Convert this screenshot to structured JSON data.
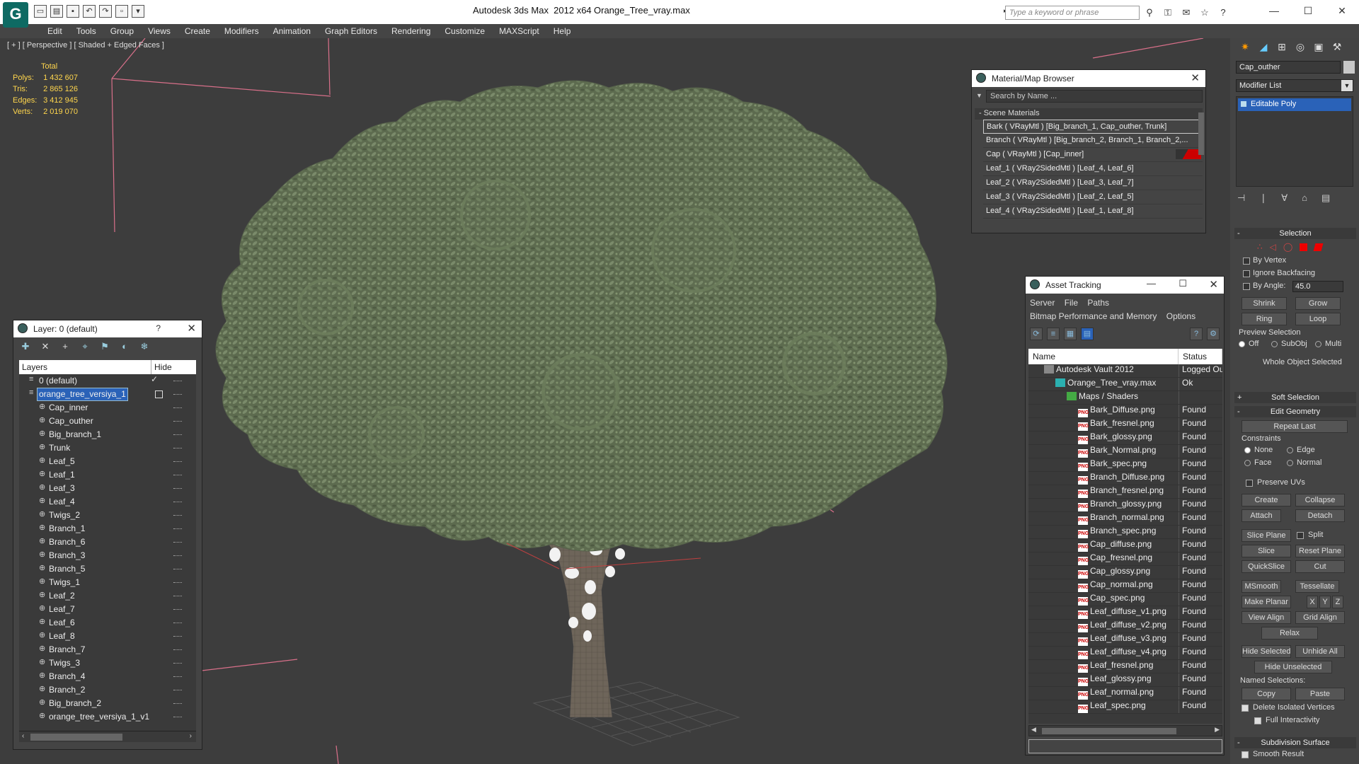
{
  "titlebar": {
    "app_title": "Autodesk 3ds Max  2012 x64",
    "file_name": "Orange_Tree_vray.max",
    "search_placeholder": "Type a keyword or phrase"
  },
  "menu": [
    "Edit",
    "Tools",
    "Group",
    "Views",
    "Create",
    "Modifiers",
    "Animation",
    "Graph Editors",
    "Rendering",
    "Customize",
    "MAXScript",
    "Help"
  ],
  "viewport": {
    "label": "[ + ] [ Perspective ] [ Shaded + Edged Faces ]",
    "stats_header": "Total",
    "stats": [
      {
        "label": "Polys:",
        "value": "1 432 607"
      },
      {
        "label": "Tris:",
        "value": "2 865 126"
      },
      {
        "label": "Edges:",
        "value": "3 412 945"
      },
      {
        "label": "Verts:",
        "value": "2 019 070"
      }
    ]
  },
  "material_browser": {
    "title": "Material/Map Browser",
    "search_placeholder": "Search by Name ...",
    "section": "- Scene Materials",
    "items": [
      "Bark  ( VRayMtl )  [Big_branch_1, Cap_outher, Trunk]",
      "Branch  ( VRayMtl )  [Big_branch_2, Branch_1, Branch_2,...",
      "Cap  ( VRayMtl )  [Cap_inner]",
      "Leaf_1  ( VRay2SidedMtl )  [Leaf_4, Leaf_6]",
      "Leaf_2  ( VRay2SidedMtl )  [Leaf_3, Leaf_7]",
      "Leaf_3  ( VRay2SidedMtl )  [Leaf_2, Leaf_5]",
      "Leaf_4  ( VRay2SidedMtl )  [Leaf_1, Leaf_8]"
    ]
  },
  "asset_tracking": {
    "title": "Asset Tracking",
    "menu1": [
      "Server",
      "File",
      "Paths"
    ],
    "menu2": [
      "Bitmap Performance and Memory",
      "Options"
    ],
    "col_name": "Name",
    "col_status": "Status",
    "rows": [
      {
        "name": "Autodesk Vault 2012",
        "status": "Logged Ou",
        "icon": "vault",
        "indent": 0
      },
      {
        "name": "Orange_Tree_vray.max",
        "status": "Ok",
        "icon": "max",
        "indent": 1
      },
      {
        "name": "Maps / Shaders",
        "status": "",
        "icon": "folder",
        "indent": 2
      },
      {
        "name": "Bark_Diffuse.png",
        "status": "Found",
        "icon": "png",
        "indent": 3
      },
      {
        "name": "Bark_fresnel.png",
        "status": "Found",
        "icon": "png",
        "indent": 3
      },
      {
        "name": "Bark_glossy.png",
        "status": "Found",
        "icon": "png",
        "indent": 3
      },
      {
        "name": "Bark_Normal.png",
        "status": "Found",
        "icon": "png",
        "indent": 3
      },
      {
        "name": "Bark_spec.png",
        "status": "Found",
        "icon": "png",
        "indent": 3
      },
      {
        "name": "Branch_Diffuse.png",
        "status": "Found",
        "icon": "png",
        "indent": 3
      },
      {
        "name": "Branch_fresnel.png",
        "status": "Found",
        "icon": "png",
        "indent": 3
      },
      {
        "name": "Branch_glossy.png",
        "status": "Found",
        "icon": "png",
        "indent": 3
      },
      {
        "name": "Branch_normal.png",
        "status": "Found",
        "icon": "png",
        "indent": 3
      },
      {
        "name": "Branch_spec.png",
        "status": "Found",
        "icon": "png",
        "indent": 3
      },
      {
        "name": "Cap_diffuse.png",
        "status": "Found",
        "icon": "png",
        "indent": 3
      },
      {
        "name": "Cap_fresnel.png",
        "status": "Found",
        "icon": "png",
        "indent": 3
      },
      {
        "name": "Cap_glossy.png",
        "status": "Found",
        "icon": "png",
        "indent": 3
      },
      {
        "name": "Cap_normal.png",
        "status": "Found",
        "icon": "png",
        "indent": 3
      },
      {
        "name": "Cap_spec.png",
        "status": "Found",
        "icon": "png",
        "indent": 3
      },
      {
        "name": "Leaf_diffuse_v1.png",
        "status": "Found",
        "icon": "png",
        "indent": 3
      },
      {
        "name": "Leaf_diffuse_v2.png",
        "status": "Found",
        "icon": "png",
        "indent": 3
      },
      {
        "name": "Leaf_diffuse_v3.png",
        "status": "Found",
        "icon": "png",
        "indent": 3
      },
      {
        "name": "Leaf_diffuse_v4.png",
        "status": "Found",
        "icon": "png",
        "indent": 3
      },
      {
        "name": "Leaf_fresnel.png",
        "status": "Found",
        "icon": "png",
        "indent": 3
      },
      {
        "name": "Leaf_glossy.png",
        "status": "Found",
        "icon": "png",
        "indent": 3
      },
      {
        "name": "Leaf_normal.png",
        "status": "Found",
        "icon": "png",
        "indent": 3
      },
      {
        "name": "Leaf_spec.png",
        "status": "Found",
        "icon": "png",
        "indent": 3
      }
    ]
  },
  "layer_panel": {
    "title": "Layer: 0 (default)",
    "help": "?",
    "col_layers": "Layers",
    "col_hide": "Hide",
    "rows": [
      {
        "name": "0 (default)",
        "indent": 1,
        "type": "layer",
        "check": true
      },
      {
        "name": "orange_tree_versiya_1",
        "indent": 1,
        "type": "layer",
        "selected": true
      },
      {
        "name": "Cap_inner",
        "indent": 2,
        "type": "obj"
      },
      {
        "name": "Cap_outher",
        "indent": 2,
        "type": "obj"
      },
      {
        "name": "Big_branch_1",
        "indent": 2,
        "type": "obj"
      },
      {
        "name": "Trunk",
        "indent": 2,
        "type": "obj"
      },
      {
        "name": "Leaf_5",
        "indent": 2,
        "type": "obj"
      },
      {
        "name": "Leaf_1",
        "indent": 2,
        "type": "obj"
      },
      {
        "name": "Leaf_3",
        "indent": 2,
        "type": "obj"
      },
      {
        "name": "Leaf_4",
        "indent": 2,
        "type": "obj"
      },
      {
        "name": "Twigs_2",
        "indent": 2,
        "type": "obj"
      },
      {
        "name": "Branch_1",
        "indent": 2,
        "type": "obj"
      },
      {
        "name": "Branch_6",
        "indent": 2,
        "type": "obj"
      },
      {
        "name": "Branch_3",
        "indent": 2,
        "type": "obj"
      },
      {
        "name": "Branch_5",
        "indent": 2,
        "type": "obj"
      },
      {
        "name": "Twigs_1",
        "indent": 2,
        "type": "obj"
      },
      {
        "name": "Leaf_2",
        "indent": 2,
        "type": "obj"
      },
      {
        "name": "Leaf_7",
        "indent": 2,
        "type": "obj"
      },
      {
        "name": "Leaf_6",
        "indent": 2,
        "type": "obj"
      },
      {
        "name": "Leaf_8",
        "indent": 2,
        "type": "obj"
      },
      {
        "name": "Branch_7",
        "indent": 2,
        "type": "obj"
      },
      {
        "name": "Twigs_3",
        "indent": 2,
        "type": "obj"
      },
      {
        "name": "Branch_4",
        "indent": 2,
        "type": "obj"
      },
      {
        "name": "Branch_2",
        "indent": 2,
        "type": "obj"
      },
      {
        "name": "Big_branch_2",
        "indent": 2,
        "type": "obj"
      },
      {
        "name": "orange_tree_versiya_1_v1",
        "indent": 2,
        "type": "obj"
      }
    ]
  },
  "command_panel": {
    "object_name": "Cap_outher",
    "modifier_list": "Modifier List",
    "stack_item": "Editable Poly",
    "selection": {
      "title": "Selection",
      "by_vertex": "By Vertex",
      "ignore_backfacing": "Ignore Backfacing",
      "by_angle": "By Angle:",
      "angle_value": "45.0",
      "shrink": "Shrink",
      "grow": "Grow",
      "ring": "Ring",
      "loop": "Loop",
      "preview_selection": "Preview Selection",
      "off": "Off",
      "subobj": "SubObj",
      "multi": "Multi",
      "whole_object": "Whole Object Selected"
    },
    "soft_selection": "Soft Selection",
    "edit_geometry": {
      "title": "Edit Geometry",
      "repeat_last": "Repeat Last",
      "constraints": "Constraints",
      "none": "None",
      "edge": "Edge",
      "face": "Face",
      "normal": "Normal",
      "preserve_uvs": "Preserve UVs",
      "create": "Create",
      "collapse": "Collapse",
      "attach": "Attach",
      "detach": "Detach",
      "slice_plane": "Slice Plane",
      "split": "Split",
      "slice": "Slice",
      "reset_plane": "Reset Plane",
      "quickslice": "QuickSlice",
      "cut": "Cut",
      "msmooth": "MSmooth",
      "tessellate": "Tessellate",
      "make_planar": "Make Planar",
      "x": "X",
      "y": "Y",
      "z": "Z",
      "view_align": "View Align",
      "grid_align": "Grid Align",
      "relax": "Relax",
      "hide_selected": "Hide Selected",
      "unhide_all": "Unhide All",
      "hide_unselected": "Hide Unselected",
      "named_selections": "Named Selections:",
      "copy": "Copy",
      "paste": "Paste",
      "delete_isolated": "Delete Isolated Vertices",
      "full_interactivity": "Full Interactivity"
    },
    "subdivision_surface": "Subdivision Surface",
    "smooth_result": "Smooth Result"
  }
}
